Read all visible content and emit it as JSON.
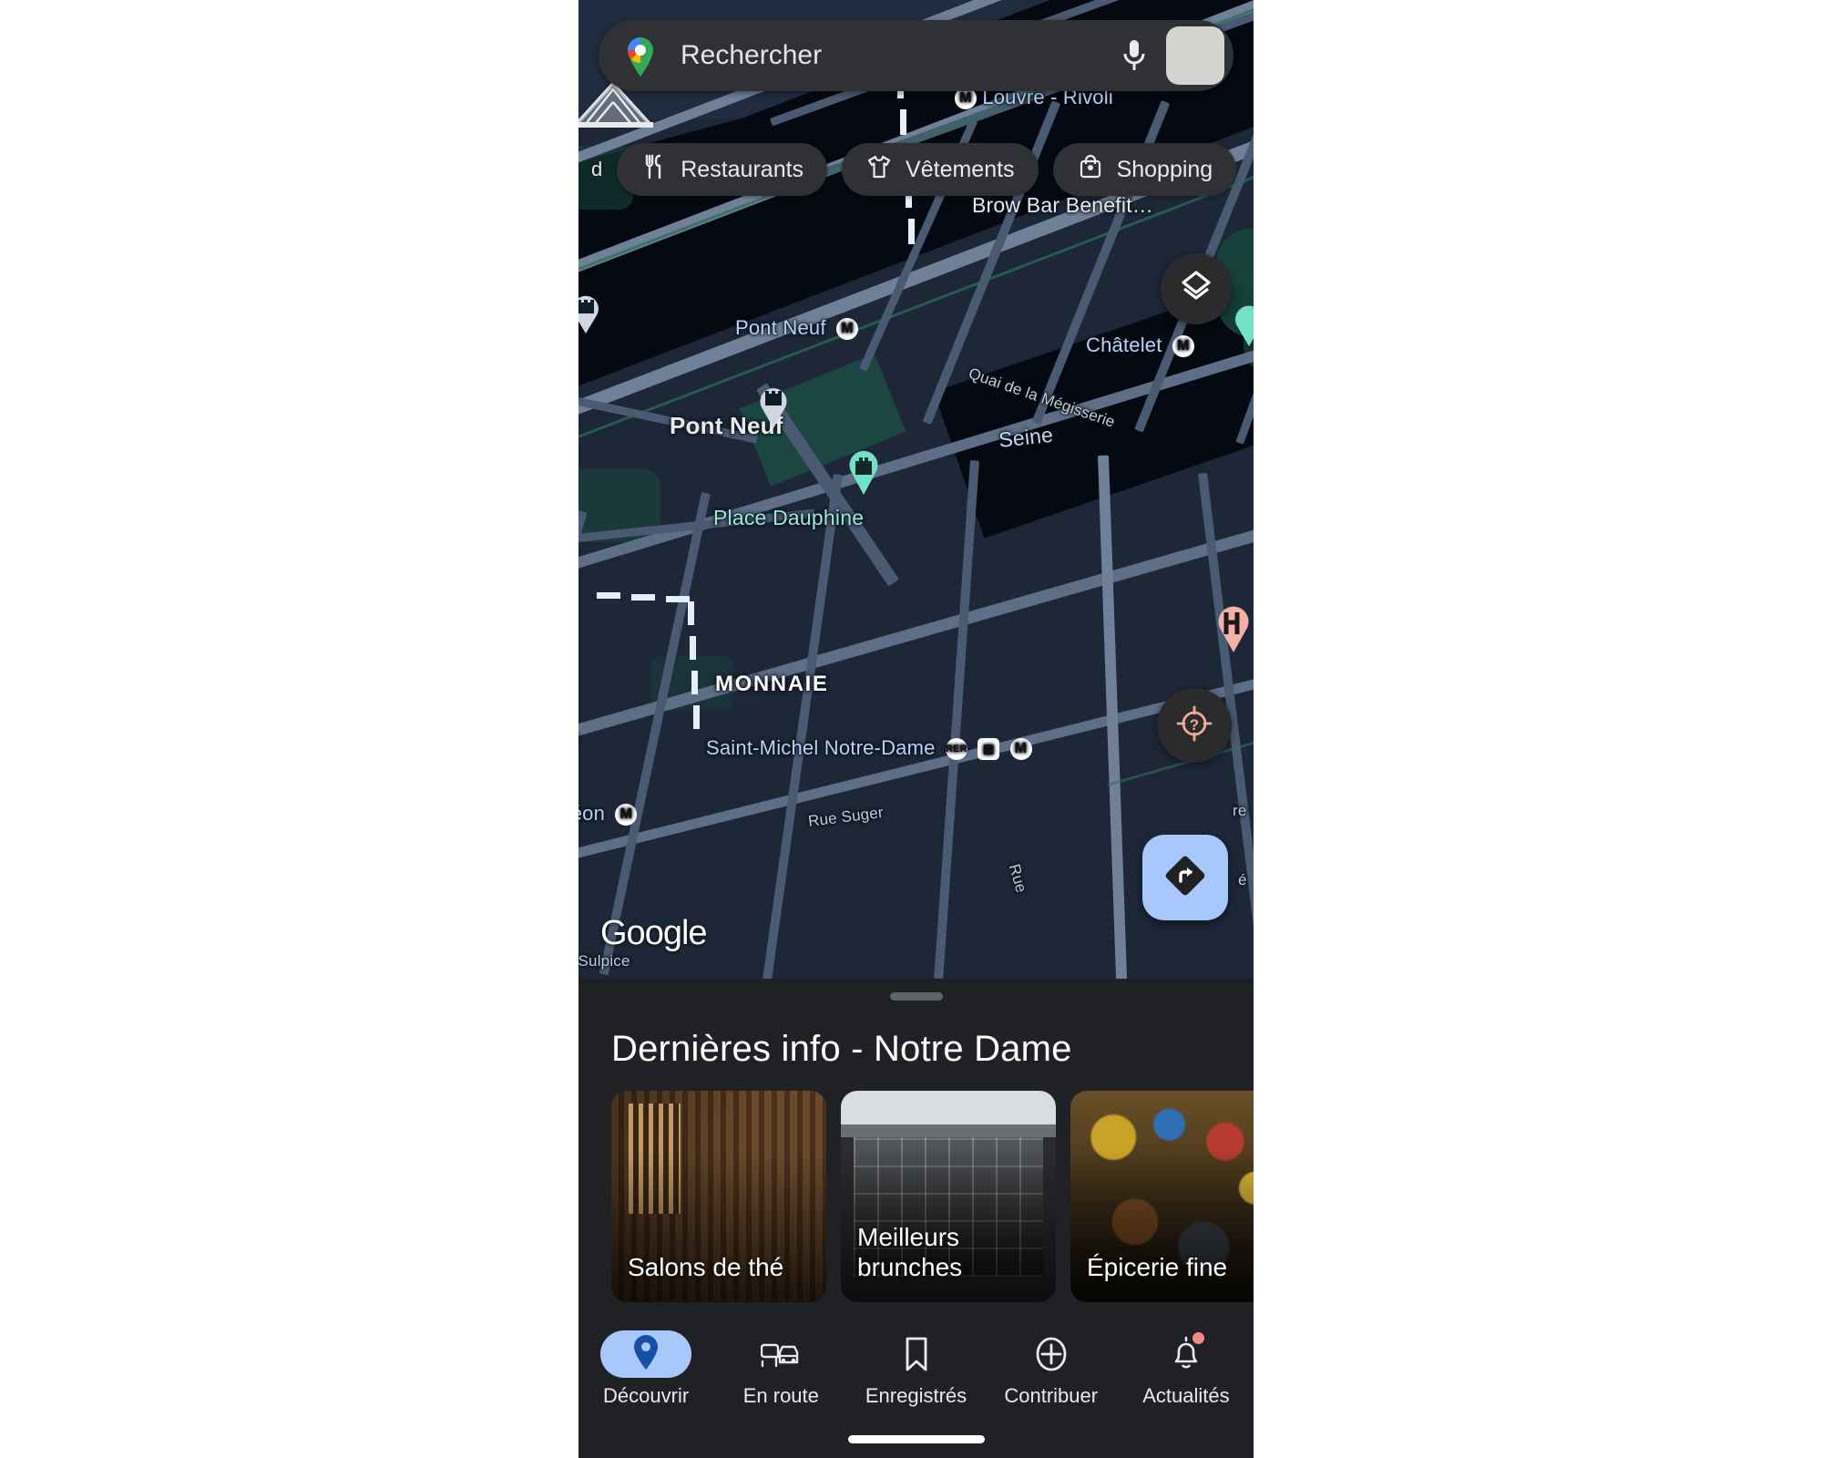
{
  "app": {
    "name": "Google Maps",
    "watermark": "Google"
  },
  "search": {
    "placeholder": "Rechercher",
    "value": "",
    "logo_icon": "google-maps-pin-icon",
    "mic_icon": "microphone-icon",
    "avatar_icon": "account-avatar"
  },
  "chips": {
    "partial_left_label": "d",
    "items": [
      {
        "label": "Restaurants",
        "icon": "restaurant-fork-knife-icon"
      },
      {
        "label": "Vêtements",
        "icon": "tshirt-icon"
      },
      {
        "label": "Shopping",
        "icon": "shopping-bag-icon"
      }
    ]
  },
  "map_controls": {
    "layers_label": "Calques",
    "layers_icon": "layers-icon",
    "locate_label": "Ma position",
    "locate_icon": "locate-unknown-icon",
    "directions_label": "Itinéraire",
    "directions_icon": "directions-arrow-icon"
  },
  "map_labels": [
    {
      "text": "Louvre - Rivoli",
      "kind": "transit"
    },
    {
      "text": "Brow Bar Benefit…",
      "kind": "poi"
    },
    {
      "text": "Pont Neuf",
      "kind": "transit"
    },
    {
      "text": "Châtelet",
      "kind": "transit"
    },
    {
      "text": "Quai de la Mégisserie",
      "kind": "street"
    },
    {
      "text": "Pont Neuf",
      "kind": "place-bold"
    },
    {
      "text": "Seine",
      "kind": "water"
    },
    {
      "text": "Place Dauphine",
      "kind": "place"
    },
    {
      "text": "MONNAIE",
      "kind": "neighborhood"
    },
    {
      "text": "Saint-Michel Notre-Dame",
      "kind": "transit"
    },
    {
      "text": "Rue Suger",
      "kind": "street"
    },
    {
      "text": "Odéon",
      "kind": "transit"
    }
  ],
  "annotation": {
    "shape": "red-arrow-and-box",
    "color": "#f61a1a",
    "points_to": "directions-fab"
  },
  "sheet": {
    "title": "Dernières info - Notre Dame",
    "cards": [
      {
        "label": "Salons de thé"
      },
      {
        "label": "Meilleurs brunches"
      },
      {
        "label": "Épicerie fine"
      }
    ]
  },
  "bottom_nav": {
    "items": [
      {
        "label": "Découvrir",
        "icon": "explore-pin-icon",
        "active": true,
        "badge": false
      },
      {
        "label": "En route",
        "icon": "commute-car-icon",
        "active": false,
        "badge": false
      },
      {
        "label": "Enregistrés",
        "icon": "bookmark-icon",
        "active": false,
        "badge": false
      },
      {
        "label": "Contribuer",
        "icon": "plus-circle-icon",
        "active": false,
        "badge": false
      },
      {
        "label": "Actualités",
        "icon": "bell-icon",
        "active": false,
        "badge": true
      }
    ]
  },
  "colors": {
    "accent_blue": "#a8c7fa",
    "annotation_red": "#f61a1a",
    "sheet_bg": "#202124",
    "chip_bg": "#303134",
    "map_water": "#050a12",
    "map_land": "#1d2738"
  }
}
